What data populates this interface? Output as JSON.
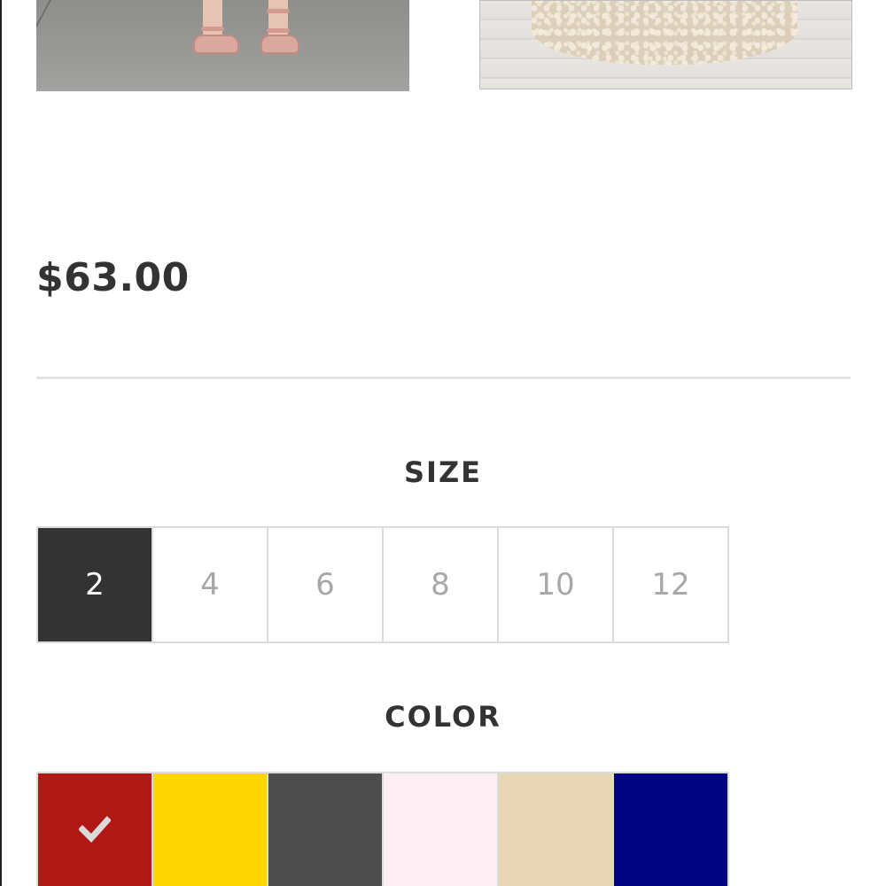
{
  "product": {
    "price": "$63.00"
  },
  "size": {
    "label": "SIZE",
    "selected": "2",
    "options": [
      "2",
      "4",
      "6",
      "8",
      "10",
      "12"
    ]
  },
  "color": {
    "label": "COLOR",
    "selected_index": 0,
    "check_icon": "checkmark-icon",
    "options": [
      {
        "name": "red",
        "hex": "#b01815"
      },
      {
        "name": "yellow",
        "hex": "#ffd600"
      },
      {
        "name": "charcoal",
        "hex": "#4d4d4d"
      },
      {
        "name": "light-pink",
        "hex": "#fdeff4"
      },
      {
        "name": "champagne",
        "hex": "#e8d7b4"
      },
      {
        "name": "navy",
        "hex": "#020483"
      }
    ]
  }
}
